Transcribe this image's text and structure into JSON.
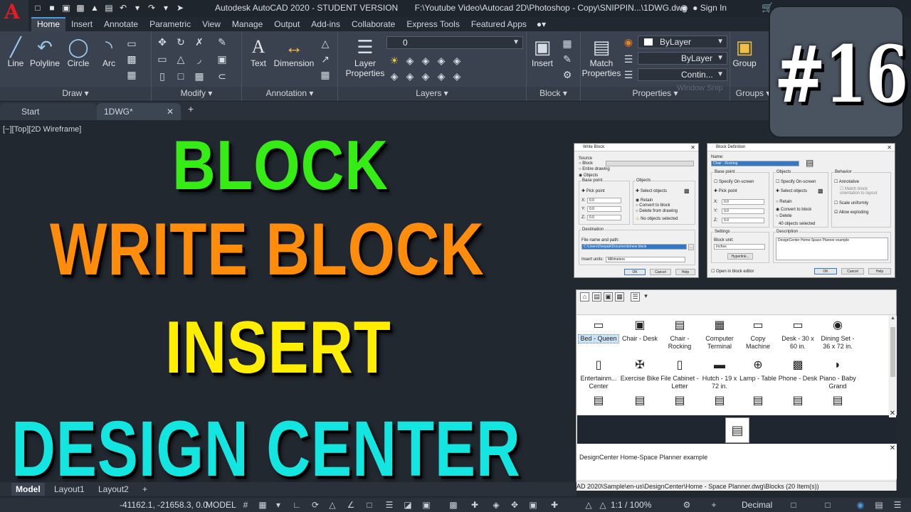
{
  "title_bar": {
    "app": "Autodesk AutoCAD 2020 - STUDENT VERSION",
    "file_path": "F:\\Youtube Video\\Autocad 2D\\Photoshop - Copy\\SNIPPIN...\\1DWG.dwg",
    "sign_in": "Sign In"
  },
  "ribbon_tabs": [
    "Home",
    "Insert",
    "Annotate",
    "Parametric",
    "View",
    "Manage",
    "Output",
    "Add-ins",
    "Collaborate",
    "Express Tools",
    "Featured Apps"
  ],
  "ribbon": {
    "draw": {
      "title": "Draw",
      "tools": [
        "Line",
        "Polyline",
        "Circle",
        "Arc"
      ]
    },
    "modify": {
      "title": "Modify"
    },
    "annotation": {
      "title": "Annotation",
      "tools": [
        "Text",
        "Dimension"
      ]
    },
    "layers": {
      "title": "Layers",
      "tool": "Layer",
      "tool2": "Properties",
      "current_layer": "0"
    },
    "block": {
      "title": "Block",
      "tool": "Insert"
    },
    "properties": {
      "title": "Properties",
      "tool": "Match",
      "tool2": "Properties",
      "color": "ByLayer",
      "lineweight": "ByLayer",
      "linetype": "Contin..."
    },
    "groups": {
      "title": "Groups",
      "tool": "Group"
    },
    "watermark": "Window Snip"
  },
  "file_tabs": {
    "start": "Start",
    "doc": "1DWG*"
  },
  "viewport_label": "[−][Top][2D Wireframe]",
  "overlay": {
    "line1": "BLOCK",
    "line2": "WRITE BLOCK",
    "line3": "INSERT",
    "line4": "DESIGN CENTER",
    "badge": "#16",
    "colors": {
      "line1": "#35ec14",
      "line2": "#ff8c0a",
      "line3": "#ffee00",
      "line4": "#13e6e0"
    }
  },
  "write_block": {
    "title": "Write Block",
    "source": "Source",
    "opt_block": "Block",
    "opt_entire": "Entire drawing",
    "opt_objects": "Objects",
    "base_point": "Base point",
    "pick_point": "Pick point",
    "x": "0.0",
    "y": "0.0",
    "z": "0.0",
    "objects": "Objects",
    "select_objects": "Select objects",
    "retain": "Retain",
    "convert": "Convert to block",
    "delete": "Delete from drawing",
    "none_selected": "No objects selected",
    "destination": "Destination",
    "file_label": "File name and path:",
    "file_value": "C:\\Users\\Deepak\\Documents\\new block",
    "units_label": "Insert units:",
    "units_value": "Millimeters",
    "ok": "OK",
    "cancel": "Cancel",
    "help": "Help"
  },
  "block_def": {
    "title": "Block Definition",
    "name_label": "Name:",
    "name_value": "Chair - Rocking",
    "base_point": "Base point",
    "specify": "Specify On-screen",
    "pick_point": "Pick point",
    "x": "0.0",
    "y": "0.0",
    "z": "0.0",
    "objects": "Objects",
    "specify2": "Specify On-screen",
    "select_objects": "Select objects",
    "retain": "Retain",
    "convert": "Convert to block",
    "delete": "Delete",
    "count": "40 objects selected",
    "behavior": "Behavior",
    "annotative": "Annotative",
    "match": "Match block orientation to layout",
    "scale": "Scale uniformly",
    "explode": "Allow exploding",
    "settings": "Settings",
    "unit_label": "Block unit:",
    "unit_value": "Inches",
    "hyperlink": "Hyperlink...",
    "description": "Description",
    "desc_value": "DesignCenter Home-Space Planner example",
    "open_editor": "Open in block editor",
    "ok": "OK",
    "cancel": "Cancel",
    "help": "Help"
  },
  "design_center": {
    "items": [
      {
        "l1": "Bed - Queen",
        "l2": "",
        "icon": "▭"
      },
      {
        "l1": "Chair - Desk",
        "l2": "",
        "icon": "▣"
      },
      {
        "l1": "Chair -",
        "l2": "Rocking",
        "icon": "▤"
      },
      {
        "l1": "Computer",
        "l2": "Terminal",
        "icon": "▦"
      },
      {
        "l1": "Copy",
        "l2": "Machine",
        "icon": "▭"
      },
      {
        "l1": "Desk - 30 x",
        "l2": "60 in.",
        "icon": "▭"
      },
      {
        "l1": "Dining Set -",
        "l2": "36 x 72 in.",
        "icon": "◉"
      },
      {
        "l1": "Entertainm...",
        "l2": "Center",
        "icon": "▯"
      },
      {
        "l1": "Exercise Bike",
        "l2": "",
        "icon": "✠"
      },
      {
        "l1": "File Cabinet -",
        "l2": "Letter",
        "icon": "▯"
      },
      {
        "l1": "Hutch - 19 x",
        "l2": "72 in.",
        "icon": "▬"
      },
      {
        "l1": "Lamp - Table",
        "l2": "",
        "icon": "⊕"
      },
      {
        "l1": "Phone - Desk",
        "l2": "",
        "icon": "▩"
      },
      {
        "l1": "Piano - Baby",
        "l2": "Grand",
        "icon": "◗"
      }
    ],
    "description": "DesignCenter Home-Space Planner example",
    "path": "AD 2020\\Sample\\en-us\\DesignCenter\\Home - Space Planner.dwg\\Blocks (20 Item(s))"
  },
  "layout_tabs": [
    "Model",
    "Layout1",
    "Layout2"
  ],
  "status": {
    "coords": "-41162.1, -21658.3, 0.0",
    "space": "MODEL",
    "scale": "1:1 / 100%",
    "units": "Decimal"
  }
}
